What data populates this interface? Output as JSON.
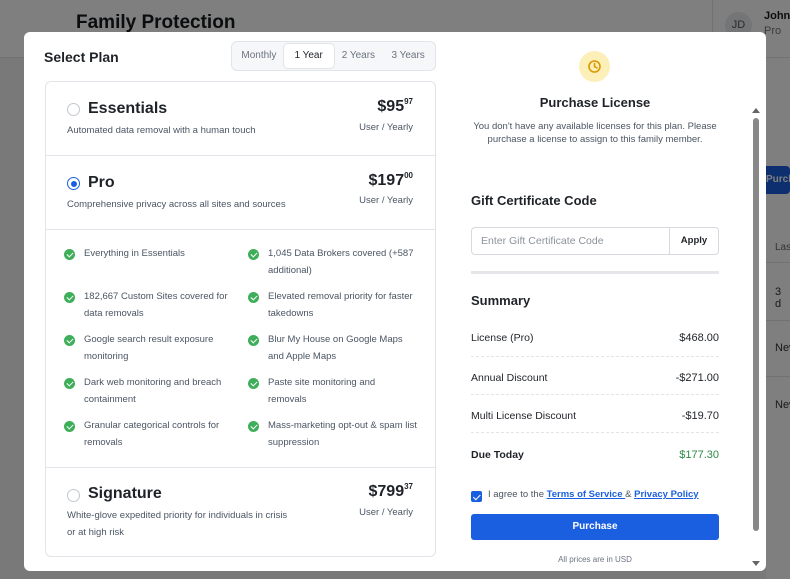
{
  "background": {
    "page_title": "Family Protection",
    "user_initials": "JD",
    "user_name": "John",
    "user_tier": "Pro",
    "purchase_fragment": "Purch",
    "table_header_fragment": "Las",
    "cells": [
      "3 d",
      "Nev",
      "Nev"
    ]
  },
  "modal": {
    "select_plan_title": "Select Plan",
    "periods": [
      "Monthly",
      "1 Year",
      "2 Years",
      "3 Years"
    ],
    "active_period": "1 Year",
    "plans": [
      {
        "name": "Essentials",
        "description": "Automated data removal with a human touch",
        "price_whole": "$95",
        "price_cents": "97",
        "unit": "User / Yearly",
        "selected": false
      },
      {
        "name": "Pro",
        "description": "Comprehensive privacy across all sites and sources",
        "price_whole": "$197",
        "price_cents": "00",
        "unit": "User / Yearly",
        "selected": true
      },
      {
        "name": "Signature",
        "description": "White-glove expedited priority for individuals in crisis or at high risk",
        "price_whole": "$799",
        "price_cents": "37",
        "unit": "User / Yearly",
        "selected": false
      }
    ],
    "features": [
      "Everything in Essentials",
      "1,045 Data Brokers covered (+587 additional)",
      "182,667 Custom Sites covered for data removals",
      "Elevated removal priority for faster takedowns",
      "Google search result exposure monitoring",
      "Blur My House on Google Maps and Apple Maps",
      "Dark web monitoring and breach containment",
      "Paste site monitoring and removals",
      "Granular categorical controls for removals",
      "Mass-marketing opt-out & spam list suppression"
    ],
    "license": {
      "title": "Purchase License",
      "message": "You don't have any available licenses for this plan. Please purchase a license to assign to this family member."
    },
    "gift": {
      "title": "Gift Certificate Code",
      "placeholder": "Enter Gift Certificate Code",
      "apply_label": "Apply"
    },
    "summary": {
      "title": "Summary",
      "rows": [
        {
          "label": "License (Pro)",
          "value": "$468.00"
        },
        {
          "label": "Annual Discount",
          "value": "-$271.00"
        },
        {
          "label": "Multi License Discount",
          "value": "-$19.70"
        },
        {
          "label": "Due Today",
          "value": "$177.30"
        }
      ]
    },
    "agree": {
      "prefix": "I agree to the ",
      "terms": "Terms of Service ",
      "amp": "& ",
      "privacy": "Privacy Policy",
      "checked": true
    },
    "purchase_label": "Purchase",
    "usd_note": "All prices are in USD"
  },
  "colors": {
    "accent": "#1a5fe0",
    "check_green": "#3fae5a",
    "due_green": "#2e8b47",
    "license_icon_bg": "#fcefb8"
  }
}
